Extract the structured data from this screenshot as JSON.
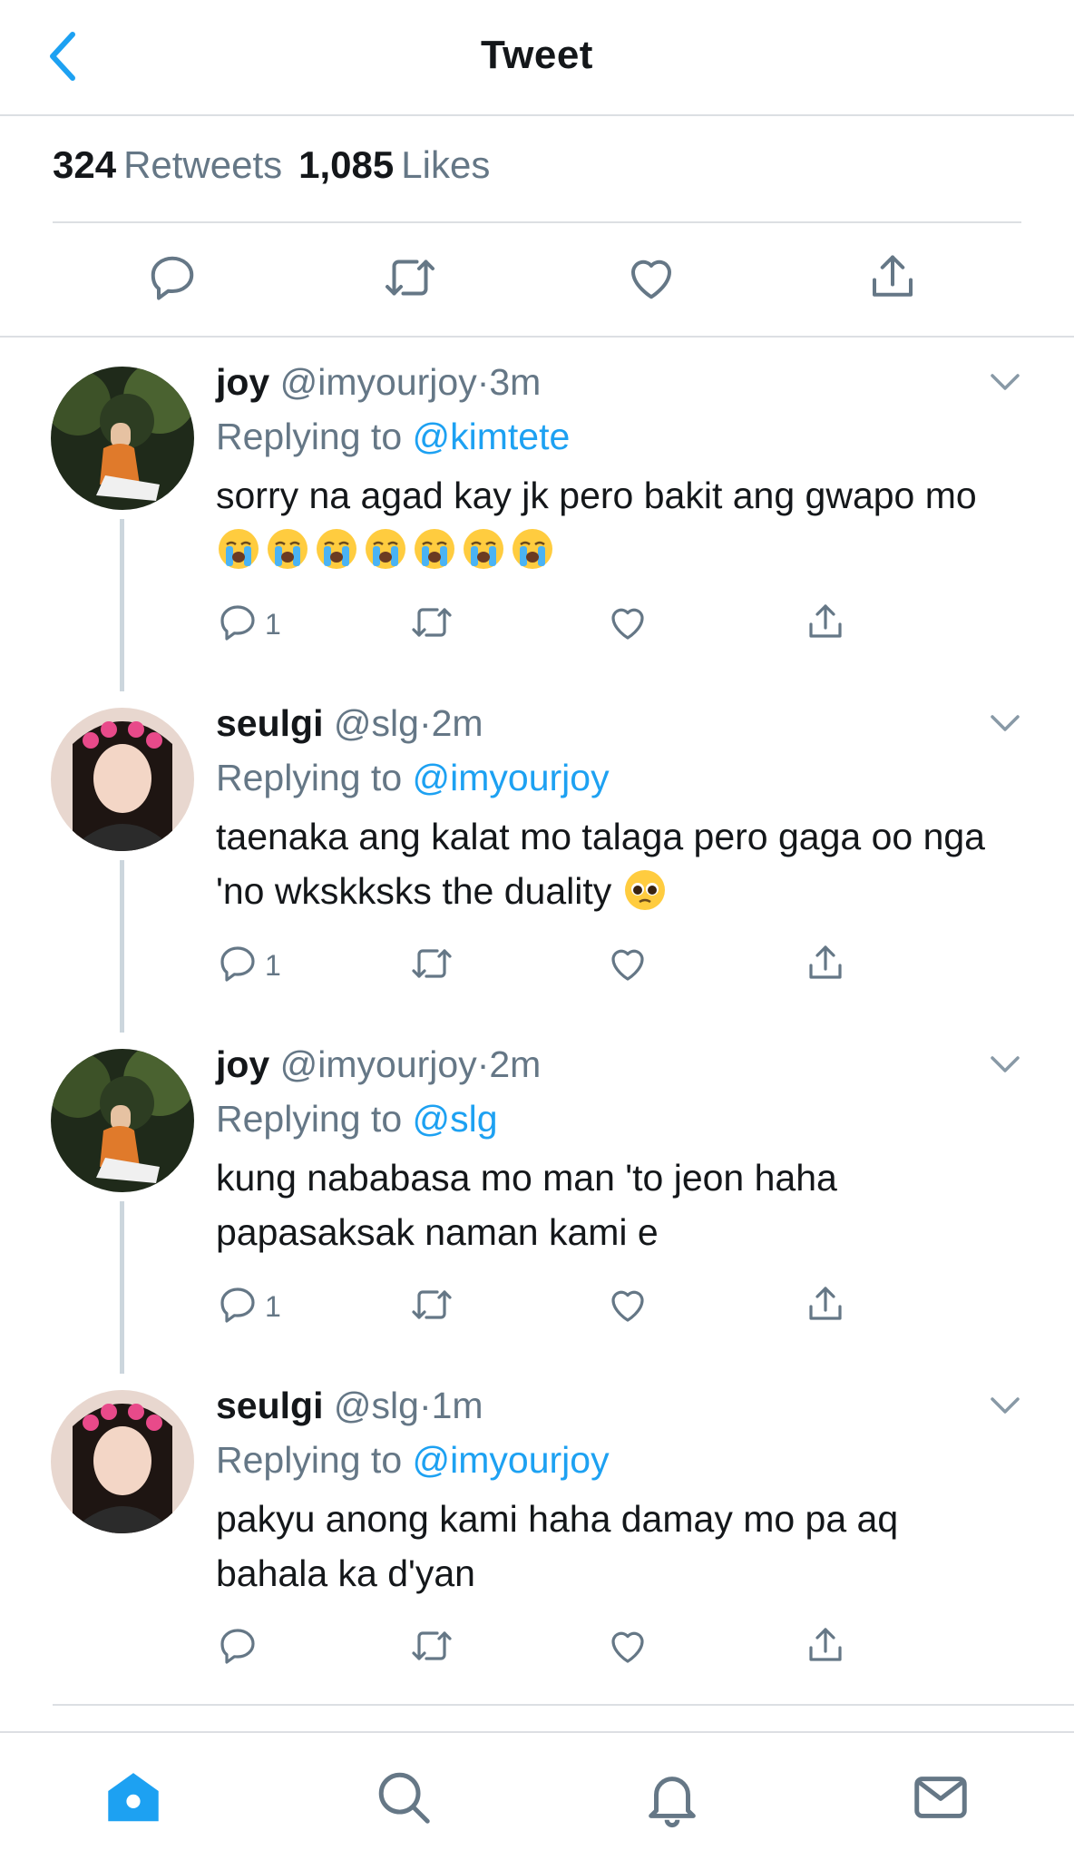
{
  "header": {
    "title": "Tweet"
  },
  "stats": {
    "retweets_count": "324",
    "retweets_label": "Retweets",
    "likes_count": "1,085",
    "likes_label": "Likes"
  },
  "replies": [
    {
      "name": "joy",
      "handle": "@imyourjoy",
      "dot": "·",
      "time": "3m",
      "replying_prefix": "Replying to",
      "replying_handle": "@kimtete",
      "text": "sorry na agad kay jk pero bakit ang gwapo mo",
      "emoji": [
        "loudly-crying-face",
        "loudly-crying-face",
        "loudly-crying-face",
        "loudly-crying-face",
        "loudly-crying-face",
        "loudly-crying-face",
        "loudly-crying-face"
      ],
      "reply_count": "1"
    },
    {
      "name": "seulgi",
      "handle": "@slg",
      "dot": "·",
      "time": "2m",
      "replying_prefix": "Replying to",
      "replying_handle": "@imyourjoy",
      "text": "taenaka ang kalat mo talaga pero gaga oo nga 'no wkskksks the duality",
      "emoji": [
        "pleading-face"
      ],
      "reply_count": "1"
    },
    {
      "name": "joy",
      "handle": "@imyourjoy",
      "dot": "·",
      "time": "2m",
      "replying_prefix": "Replying to",
      "replying_handle": "@slg",
      "text": "kung nababasa mo man 'to jeon haha papasaksak naman kami e",
      "emoji": [],
      "reply_count": "1"
    },
    {
      "name": "seulgi",
      "handle": "@slg",
      "dot": "·",
      "time": "1m",
      "replying_prefix": "Replying to",
      "replying_handle": "@imyourjoy",
      "text": "pakyu anong kami haha damay mo pa aq bahala ka d'yan",
      "emoji": [],
      "reply_count": ""
    }
  ],
  "colors": {
    "accent": "#1da1f2",
    "icon_gray": "#657786",
    "tab_active": "#1da1f2",
    "divider": "#dcdfe3"
  },
  "tabbar": [
    "home-icon",
    "search-icon",
    "notifications-icon",
    "messages-icon"
  ]
}
